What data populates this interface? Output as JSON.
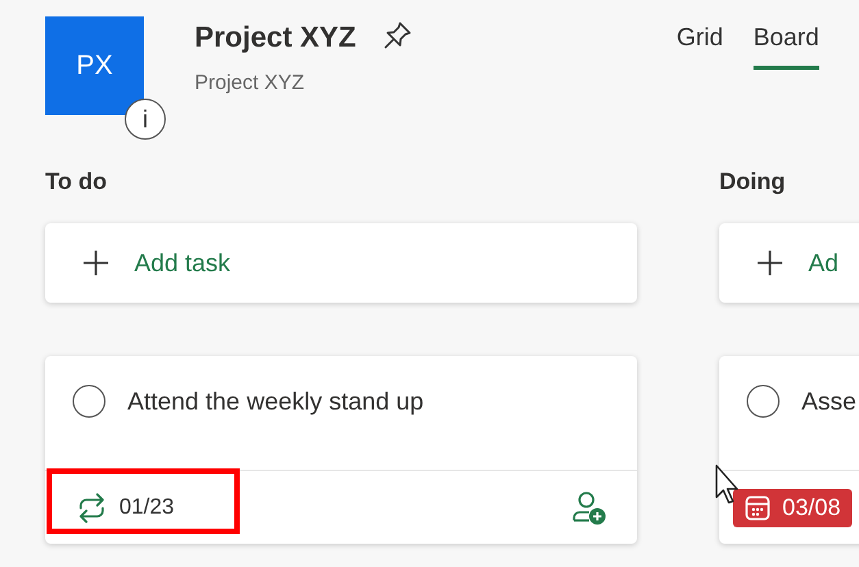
{
  "project": {
    "initials": "PX",
    "title": "Project XYZ",
    "subtitle": "Project XYZ",
    "info_badge": "i"
  },
  "views": [
    {
      "label": "Grid",
      "selected": false
    },
    {
      "label": "Board",
      "selected": true
    }
  ],
  "buckets": [
    {
      "name": "To do",
      "add_label": "Add task",
      "tasks": [
        {
          "title": "Attend the weekly stand up",
          "completed": false,
          "can_assign": true,
          "footer": {
            "kind": "recurrence",
            "text": "01/23",
            "highlighted": true,
            "overdue": false
          }
        }
      ]
    },
    {
      "name": "Doing",
      "add_label": "Ad",
      "tasks": [
        {
          "title": "Asse",
          "completed": false,
          "can_assign": false,
          "footer": {
            "kind": "due",
            "text": "03/08",
            "highlighted": false,
            "overdue": true
          }
        }
      ]
    }
  ]
}
